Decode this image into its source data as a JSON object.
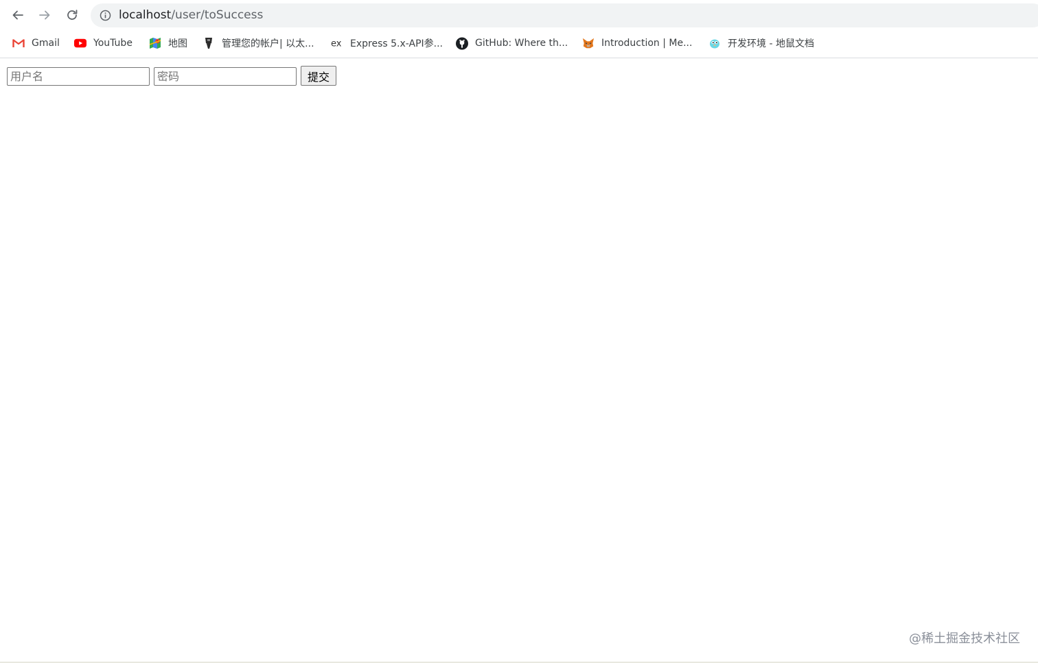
{
  "browser": {
    "url_host": "localhost",
    "url_path": "/user/toSuccess",
    "bookmarks": [
      {
        "label": "Gmail",
        "icon": "gmail-icon"
      },
      {
        "label": "YouTube",
        "icon": "youtube-icon"
      },
      {
        "label": "地图",
        "icon": "maps-icon"
      },
      {
        "label": "管理您的帐户| 以太...",
        "icon": "account-icon"
      },
      {
        "label": "Express 5.x-API参...",
        "icon": "express-icon"
      },
      {
        "label": "GitHub: Where th...",
        "icon": "github-icon"
      },
      {
        "label": "Introduction | Me...",
        "icon": "metamask-icon"
      },
      {
        "label": "开发环境 - 地鼠文档",
        "icon": "gopher-icon"
      }
    ]
  },
  "form": {
    "username_placeholder": "用户名",
    "password_placeholder": "密码",
    "submit_label": "提交"
  },
  "watermark": "@稀土掘金技术社区",
  "colors": {
    "omnibox_bg": "#f1f3f4",
    "youtube_red": "#ff0000",
    "gmail_red": "#ea4335"
  }
}
